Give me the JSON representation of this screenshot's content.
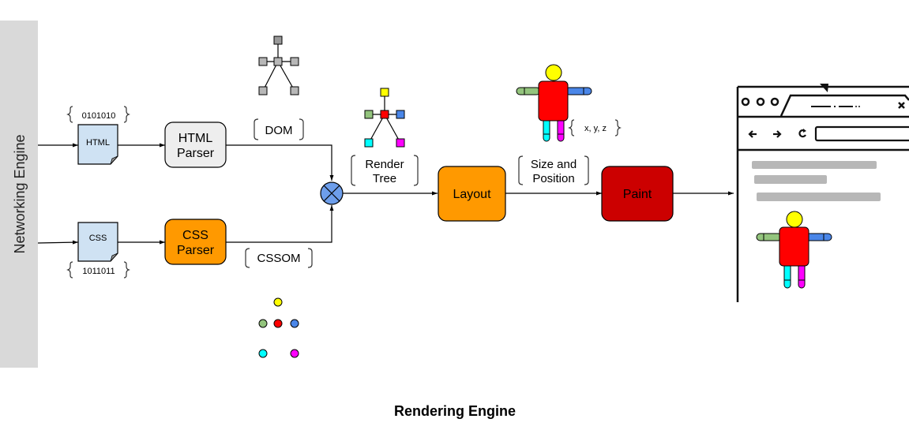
{
  "diagram": {
    "title": "Rendering Engine",
    "sidebar": {
      "label": "Networking Engine"
    },
    "inputs": {
      "html_doc": {
        "label": "HTML",
        "bytes": "0101010"
      },
      "css_doc": {
        "label": "CSS",
        "bytes": "1011011"
      }
    },
    "nodes": {
      "html_parser": {
        "line1": "HTML",
        "line2": "Parser",
        "fill": "#eeeeee"
      },
      "css_parser": {
        "line1": "CSS",
        "line2": "Parser",
        "fill": "#ff9900"
      },
      "combine": {
        "fill": "#6d9eeb"
      },
      "layout": {
        "label": "Layout",
        "fill": "#ff9900"
      },
      "paint": {
        "label": "Paint",
        "fill": "#cc0000"
      }
    },
    "edge_labels": {
      "dom": "DOM",
      "cssom": "CSSOM",
      "render_tree": {
        "line1": "Render",
        "line2": "Tree"
      },
      "size_position": {
        "line1": "Size and",
        "line2": "Position"
      },
      "coords": "x, y, z"
    },
    "colors": {
      "yellow": "#ffff00",
      "green": "#93c47d",
      "red": "#ff0000",
      "blue": "#4a86e8",
      "cyan": "#00ffff",
      "magenta": "#ff00ff",
      "gray_node": "#b7b7b7",
      "doc_fill": "#cfe2f3",
      "sidebar": "#d9d9d9",
      "skeleton_bar": "#b7b7b7"
    }
  }
}
